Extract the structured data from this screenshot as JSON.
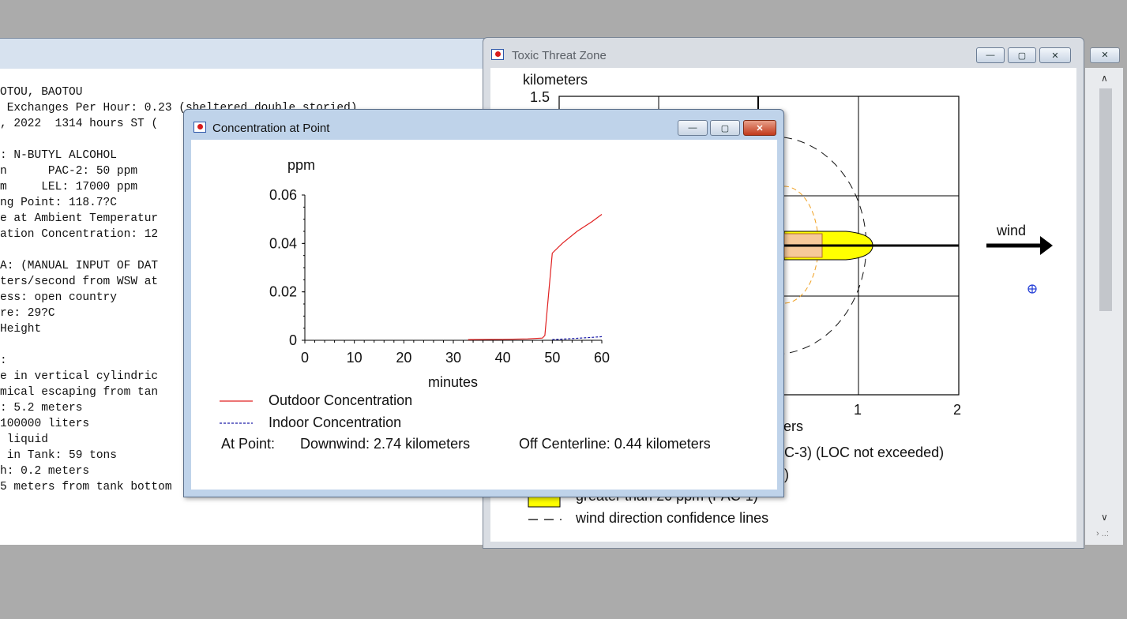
{
  "text_window": {
    "lines": [
      "OTOU, BAOTOU",
      " Exchanges Per Hour: 0.23 (sheltered double storied)",
      ", 2022  1314 hours ST (",
      "",
      ": N-BUTYL ALCOHOL",
      "n      PAC-2: 50 ppm",
      "m     LEL: 17000 ppm",
      "ng Point: 118.7?C",
      "e at Ambient Temperatur",
      "ation Concentration: 12",
      "",
      "A: (MANUAL INPUT OF DAT",
      "ters/second from WSW at",
      "ess: open country",
      "re: 29?C",
      "Height",
      "",
      ":",
      "e in vertical cylindric",
      "mical escaping from tan",
      ": 5.2 meters",
      "100000 liters",
      " liquid",
      " in Tank: 59 tons",
      "h: 0.2 meters",
      "5 meters from tank bottom"
    ]
  },
  "threat_window": {
    "title": "Toxic Threat Zone",
    "y_unit": "kilometers",
    "y_tick_top": "1.5",
    "x_ticks": [
      "1",
      "2"
    ],
    "x_unit_partial": "ers",
    "wind_label": "wind",
    "legend": [
      {
        "text": "C-3) (LOC not exceeded)"
      },
      {
        "text": ")"
      },
      {
        "text": "greater than 20 ppm (PAC-1)"
      },
      {
        "text": "wind direction confidence lines"
      }
    ],
    "colors": {
      "yellow": "#ffff00",
      "orange_dash": "#f0a020",
      "point_marker": "#1f3ad6"
    }
  },
  "concentration_window": {
    "title": "Concentration at Point",
    "ylabel": "ppm",
    "xlabel": "minutes",
    "legend_outdoor": "Outdoor Concentration",
    "legend_indoor": "Indoor Concentration",
    "at_point_label": "At Point:",
    "downwind": "Downwind: 2.74 kilometers",
    "off_centerline": "Off Centerline: 0.44 kilometers"
  },
  "chart_data": {
    "type": "line",
    "xlabel": "minutes",
    "ylabel": "ppm",
    "xlim": [
      0,
      60
    ],
    "ylim": [
      0,
      0.06
    ],
    "x_ticks": [
      0,
      10,
      20,
      30,
      40,
      50,
      60
    ],
    "y_ticks": [
      0,
      0.02,
      0.04,
      0.06
    ],
    "y_tick_labels": [
      "0",
      "0.02",
      "0.04",
      "0.06"
    ],
    "series": [
      {
        "name": "Outdoor Concentration",
        "color": "#e02020",
        "style": "solid",
        "x": [
          33,
          40,
          45,
          48,
          48.5,
          50,
          52,
          55,
          58,
          60
        ],
        "y": [
          0.0003,
          0.0004,
          0.0006,
          0.0009,
          0.002,
          0.036,
          0.04,
          0.045,
          0.049,
          0.052
        ]
      },
      {
        "name": "Indoor Concentration",
        "color": "#1a1aa8",
        "style": "dashed",
        "x": [
          50,
          52,
          55,
          58,
          60
        ],
        "y": [
          0.0003,
          0.0005,
          0.0008,
          0.0012,
          0.0015
        ]
      }
    ]
  }
}
